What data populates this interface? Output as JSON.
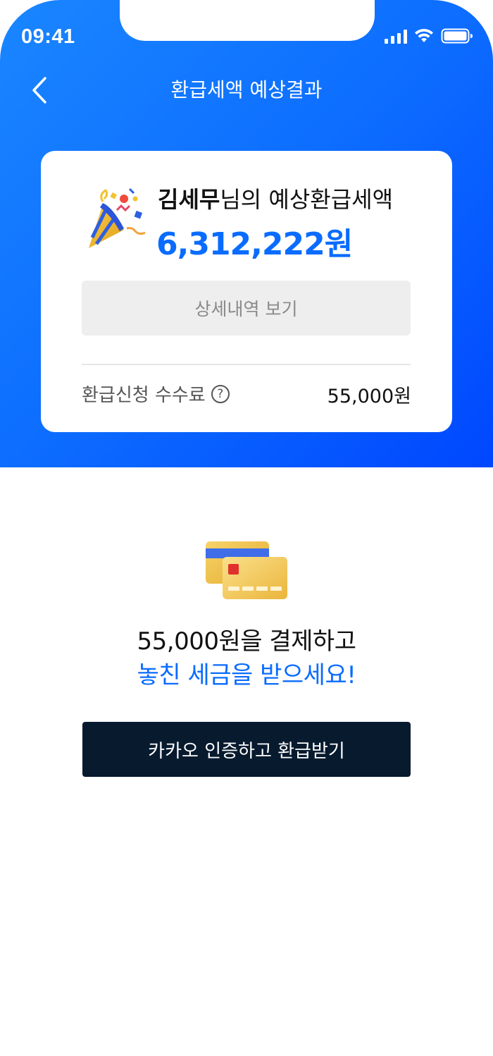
{
  "status_bar": {
    "time": "09:41",
    "icons": [
      "signal-icon",
      "wifi-icon",
      "battery-icon"
    ]
  },
  "nav": {
    "back_icon": "chevron-left-icon",
    "title": "환급세액 예상결과"
  },
  "summary_card": {
    "icon": "party-popper-icon",
    "user_name": "김세무",
    "label_suffix": "님의 예상환급세액",
    "refund_amount": "6,312,222원",
    "detail_button_label": "상세내역 보기",
    "fee_label": "환급신청 수수료",
    "fee_help_icon": "?",
    "fee_value": "55,000원"
  },
  "promo": {
    "icon": "credit-cards-icon",
    "line1": "55,000원을 결제하고",
    "line2": "놓친 세금을 받으세요!"
  },
  "cta": {
    "label": "카카오 인증하고 환급받기"
  },
  "colors": {
    "hero_gradient_start": "#1a86ff",
    "hero_gradient_end": "#0047ff",
    "accent_blue": "#0a6cff",
    "cta_background": "#071a2e",
    "detail_button_bg": "#eeeeee"
  }
}
